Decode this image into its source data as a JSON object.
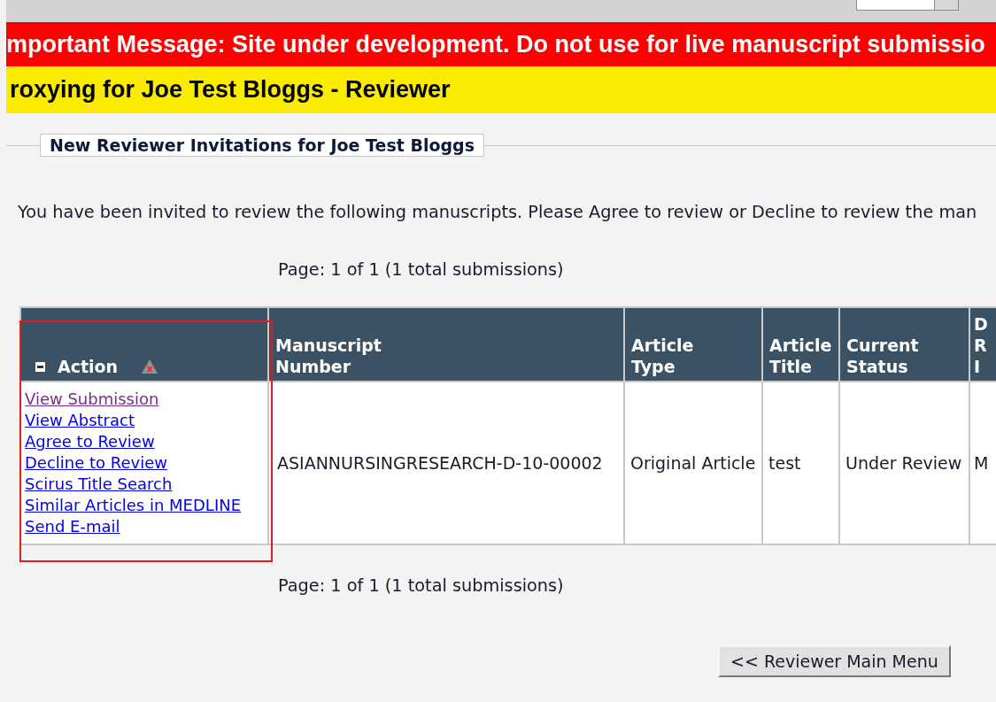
{
  "top_bar": {
    "dropdown": true
  },
  "important_banner": "mportant Message:  Site under development. Do not use for live manuscript submissio",
  "proxy_banner": "roxying for Joe Test Bloggs - Reviewer",
  "section_title": "New Reviewer Invitations for Joe Test Bloggs",
  "intro": "You have been invited to review the following manuscripts. Please Agree to review or Decline to review the man",
  "pager_top": "Page: 1 of 1 (1 total submissions)",
  "table": {
    "columns": [
      {
        "lines": [
          "Action"
        ],
        "kind": "action"
      },
      {
        "lines": [
          "Manuscript",
          "Number"
        ],
        "kind": "text"
      },
      {
        "lines": [
          "Article",
          "Type"
        ],
        "kind": "text"
      },
      {
        "lines": [
          "Article",
          "Title"
        ],
        "kind": "text"
      },
      {
        "lines": [
          "Current",
          "Status"
        ],
        "kind": "text"
      },
      {
        "lines": [
          "D",
          "R",
          "I"
        ],
        "kind": "text"
      }
    ],
    "rows": [
      {
        "cells": [
          {
            "kind": "links",
            "links": [
              {
                "label": "View Submission",
                "visited": true
              },
              {
                "label": "View Abstract",
                "visited": false
              },
              {
                "label": "Agree to Review",
                "visited": false
              },
              {
                "label": "Decline to Review",
                "visited": false
              },
              {
                "label": "Scirus Title Search",
                "visited": false
              },
              {
                "label": "Similar Articles in MEDLINE",
                "visited": false
              },
              {
                "label": "Send E-mail",
                "visited": false
              }
            ]
          },
          {
            "kind": "text",
            "text": "ASIANNURSINGRESEARCH-D-10-00002"
          },
          {
            "kind": "text",
            "text": "Original Article"
          },
          {
            "kind": "text",
            "text": "test"
          },
          {
            "kind": "text",
            "text": "Under Review"
          },
          {
            "kind": "text",
            "text": "M"
          }
        ]
      }
    ]
  },
  "highlight_action_column": true,
  "pager_bottom": "Page: 1 of 1 (1 total submissions)",
  "main_menu_button": "<< Reviewer Main Menu"
}
